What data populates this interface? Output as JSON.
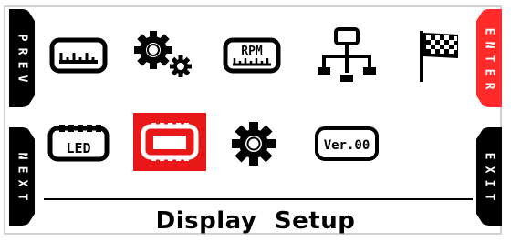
{
  "colors": {
    "enter_button": "#ff2a2a",
    "selected_tile": "#e81818",
    "side_buttons": "#000000"
  },
  "buttons": {
    "prev": "PREV",
    "enter": "ENTER",
    "next": "NEXT",
    "exit": "EXIT"
  },
  "icons": [
    {
      "name": "gauge-icon"
    },
    {
      "name": "gears-icon"
    },
    {
      "name": "rpm-gauge-icon",
      "label": "RPM"
    },
    {
      "name": "network-tree-icon"
    },
    {
      "name": "checkered-flag-icon"
    },
    {
      "name": "led-icon",
      "label": "LED"
    },
    {
      "name": "display-icon",
      "selected": true
    },
    {
      "name": "gear-icon"
    },
    {
      "name": "version-icon",
      "label": "Ver.00"
    }
  ],
  "title": "Display Setup"
}
